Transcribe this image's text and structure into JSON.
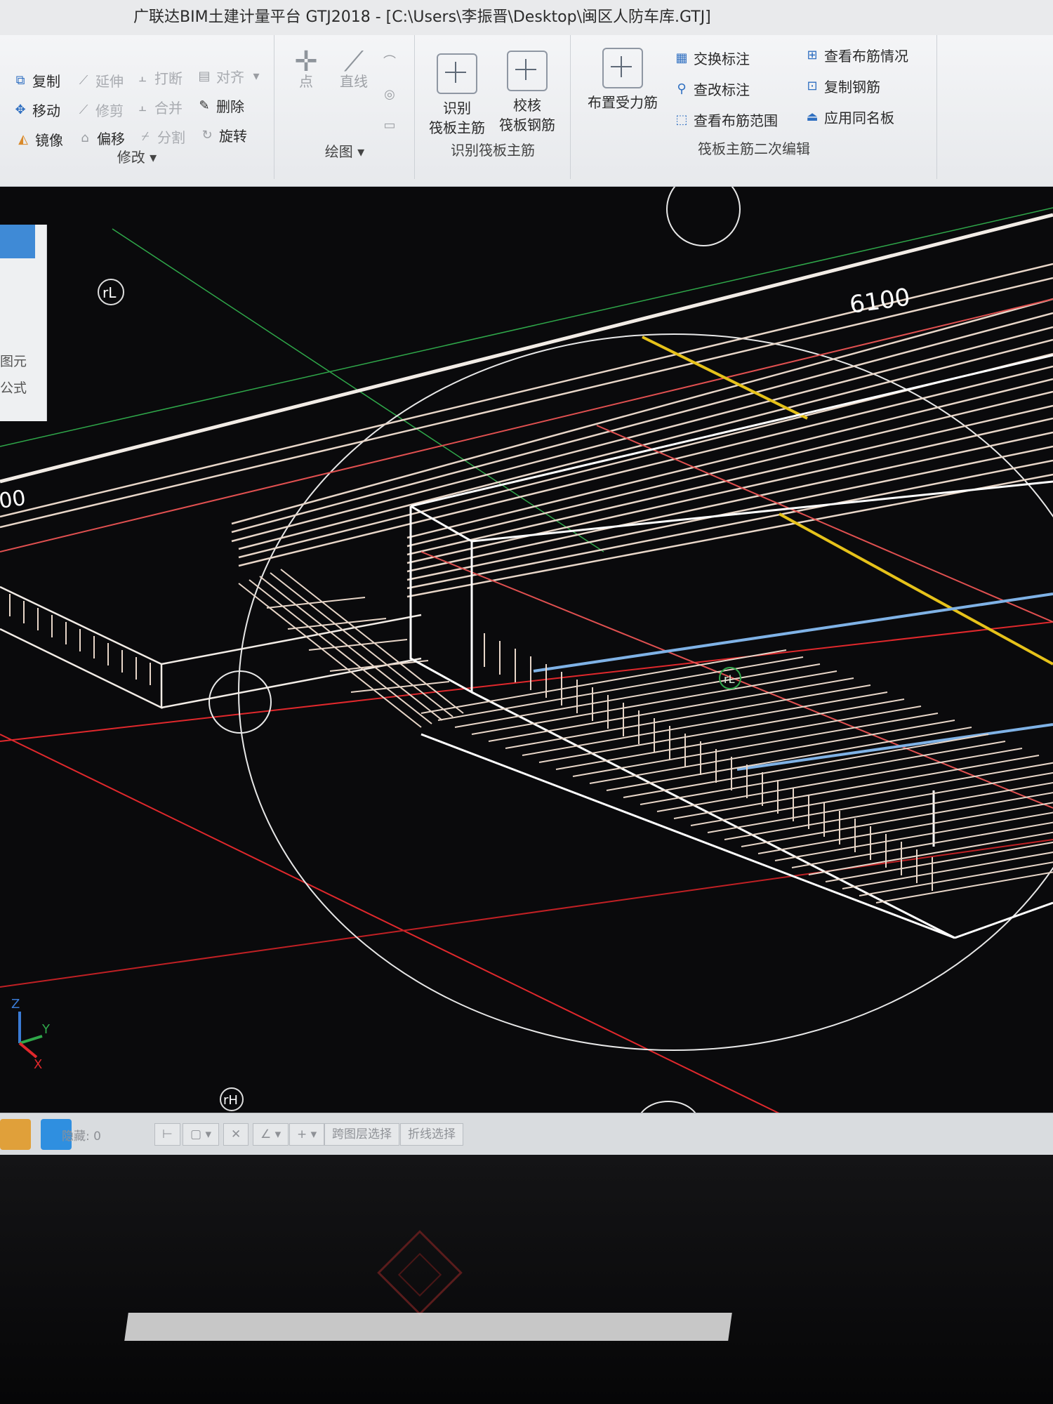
{
  "window": {
    "title": "广联达BIM土建计量平台 GTJ2018 - [C:\\Users\\李振晋\\Desktop\\闽区人防车库.GTJ]"
  },
  "ribbon": {
    "modify": {
      "label": "修改",
      "buttons": [
        {
          "label": "复制",
          "icon": "copy-icon",
          "enabled": true
        },
        {
          "label": "延伸",
          "icon": "extend-icon",
          "enabled": false
        },
        {
          "label": "打断",
          "icon": "break-icon",
          "enabled": false
        },
        {
          "label": "对齐",
          "icon": "align-icon",
          "enabled": false
        },
        {
          "label": "移动",
          "icon": "move-icon",
          "enabled": true
        },
        {
          "label": "修剪",
          "icon": "trim-icon",
          "enabled": false
        },
        {
          "label": "合并",
          "icon": "merge-icon",
          "enabled": false
        },
        {
          "label": "删除",
          "icon": "delete-icon",
          "enabled": true
        },
        {
          "label": "镜像",
          "icon": "mirror-icon",
          "enabled": true
        },
        {
          "label": "偏移",
          "icon": "offset-icon",
          "enabled": true
        },
        {
          "label": "分割",
          "icon": "split-icon",
          "enabled": false
        },
        {
          "label": "旋转",
          "icon": "rotate-icon",
          "enabled": true
        }
      ]
    },
    "draw": {
      "label": "绘图",
      "point_label": "点",
      "line_label": "直线"
    },
    "identify": {
      "label": "识别筏板主筋",
      "identify_btn_line1": "识别",
      "identify_btn_line2": "筏板主筋",
      "check_btn_line1": "校核",
      "check_btn_line2": "筏板钢筋"
    },
    "secondary": {
      "label": "筏板主筋二次编辑",
      "place_btn": "布置受力筋",
      "items": [
        {
          "label": "交换标注"
        },
        {
          "label": "查看布筋情况"
        },
        {
          "label": "查改标注"
        },
        {
          "label": "复制钢筋"
        },
        {
          "label": "查看布筋范围"
        },
        {
          "label": "应用同名板"
        }
      ]
    }
  },
  "left_panel": {
    "lines": [
      "图元",
      "公式"
    ]
  },
  "viewport": {
    "dimension_top": "6100",
    "dimension_left": "00",
    "gizmo_labels": {
      "top_left": "rL",
      "center": "rL",
      "bottom": "rH"
    },
    "axes": {
      "z": "Z",
      "y": "Y",
      "x": "X"
    },
    "colors": {
      "background": "#0a0a0c",
      "rebar": "#e8d6c8",
      "edge": "#ffffff",
      "axis_red": "#e0282c",
      "axis_green": "#2fa84a",
      "highlight_yellow": "#e6c21a",
      "highlight_blue": "#7fb2e6"
    }
  },
  "statusbar": {
    "hidden_label": "隐藏: 0",
    "cross_layer_btn": "跨图层选择",
    "polyline_btn": "折线选择"
  }
}
